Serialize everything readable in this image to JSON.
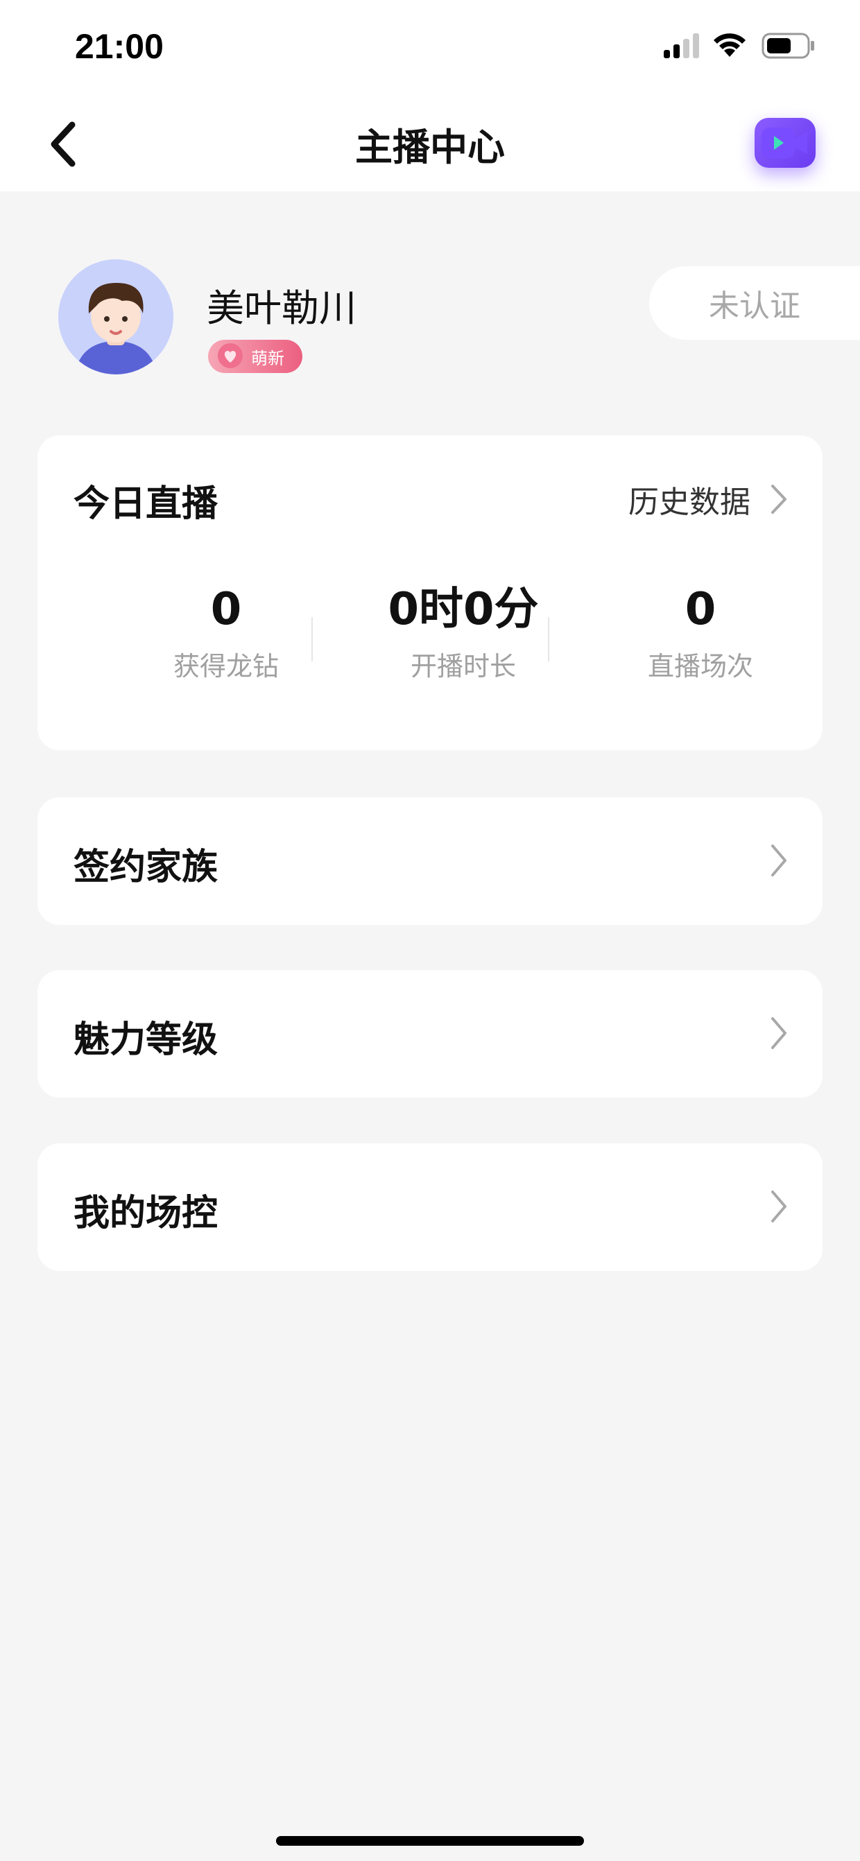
{
  "status_bar": {
    "time": "21:00",
    "icons": [
      "cellular-signal-icon",
      "wifi-icon",
      "battery-icon"
    ]
  },
  "nav": {
    "title": "主播中心",
    "back_icon": "chevron-left-icon",
    "action_icon": "video-camera-icon",
    "action_color": "#7b4dff"
  },
  "profile": {
    "name": "美叶勒川",
    "badge_label": "萌新",
    "badge_color": "#ec5f80",
    "verify_status": "未认证"
  },
  "today": {
    "title": "今日直播",
    "history_label": "历史数据",
    "stats": [
      {
        "value": "0",
        "label": "获得龙钻"
      },
      {
        "value": "0时0分",
        "label": "开播时长"
      },
      {
        "value": "0",
        "label": "直播场次"
      }
    ]
  },
  "menu": [
    {
      "label": "签约家族"
    },
    {
      "label": "魅力等级"
    },
    {
      "label": "我的场控"
    }
  ]
}
